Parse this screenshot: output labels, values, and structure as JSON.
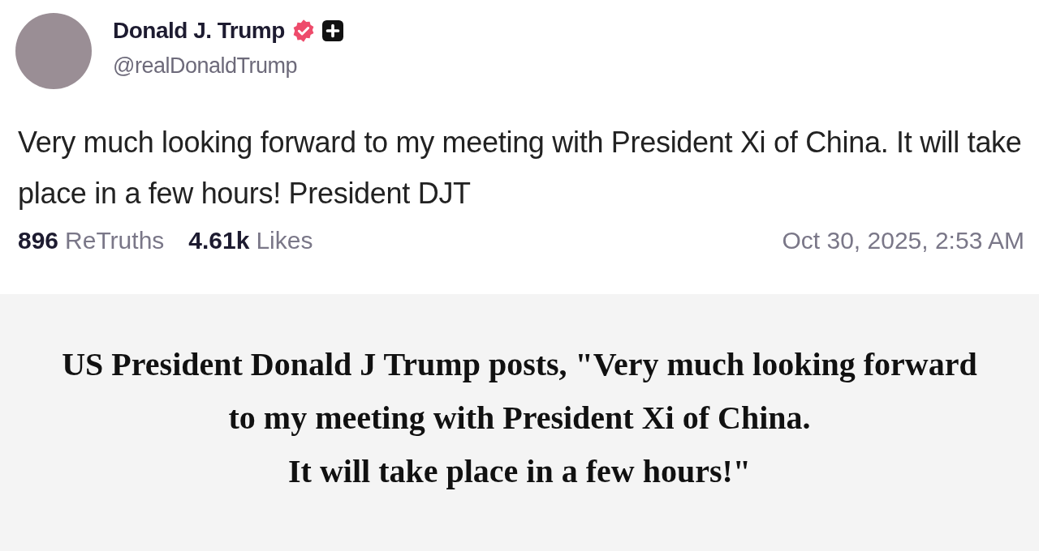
{
  "post": {
    "author": {
      "name": "Donald J. Trump",
      "verified": true,
      "handle": "@realDonaldTrump"
    },
    "text": "Very much looking forward to my meeting with President Xi of China. It will take place in a few hours! President DJT",
    "stats": [
      {
        "count": "896",
        "label": "ReTruths"
      },
      {
        "count": "4.61k",
        "label": "Likes"
      }
    ],
    "timestamp": "Oct 30, 2025, 2:53 AM"
  },
  "caption": {
    "lines": [
      "US President Donald J Trump posts, \"Very much looking forward",
      "to my meeting with President Xi of China.",
      "It will take place in a few hours!\""
    ]
  }
}
